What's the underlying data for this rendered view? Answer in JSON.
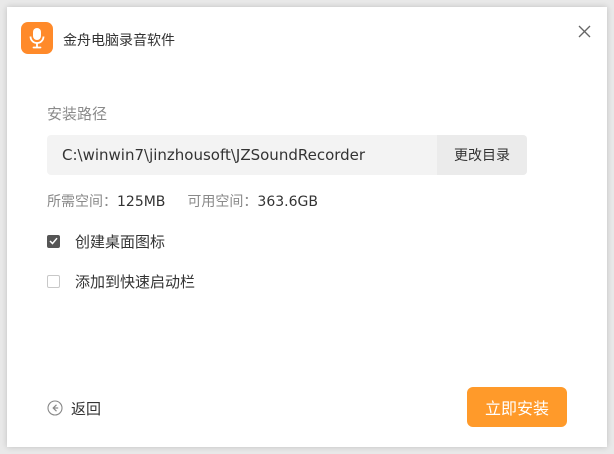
{
  "window": {
    "title": "金舟电脑录音软件",
    "icon": "microphone-icon",
    "close_icon": "close-icon"
  },
  "install": {
    "path_label": "安装路径",
    "path_value": "C:\\winwin7\\jinzhousoft\\JZSoundRecorder",
    "browse_label": "更改目录",
    "required_label": "所需空间：",
    "required_value": "125MB",
    "available_label": "可用空间：",
    "available_value": "363.6GB"
  },
  "options": [
    {
      "label": "创建桌面图标",
      "checked": true
    },
    {
      "label": "添加到快速启动栏",
      "checked": false
    }
  ],
  "footer": {
    "back_label": "返回",
    "back_icon": "back-arrow-icon",
    "install_label": "立即安装"
  },
  "colors": {
    "accent": "#ff9a2a",
    "icon_bg": "#ff8a2a",
    "checkbox_checked": "#555555"
  }
}
